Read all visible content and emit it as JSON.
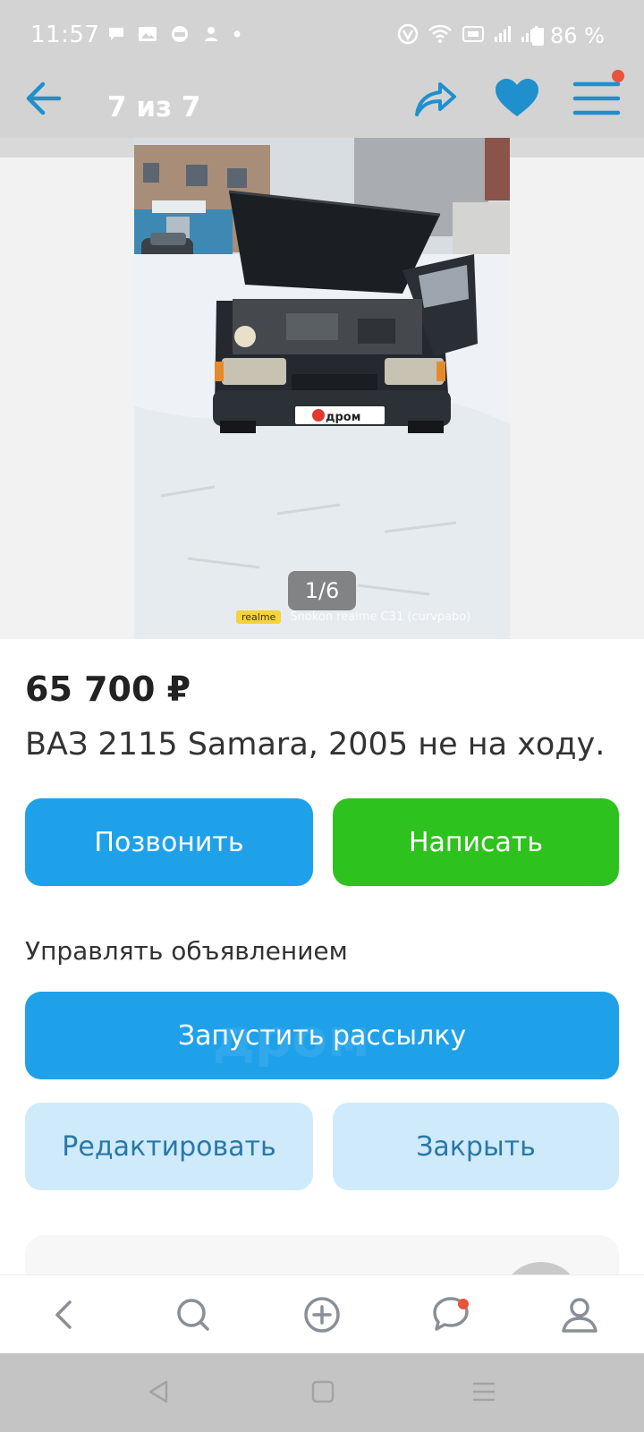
{
  "status_bar": {
    "time": "11:57",
    "battery_percent": "86 %",
    "notification_icons": [
      "chat-bubble-icon",
      "image-icon",
      "car-icon",
      "person-icon",
      "dot-icon"
    ],
    "system_icons": [
      "vpn-icon",
      "wifi-icon",
      "volte-icon",
      "signal-icon",
      "signal-icon"
    ]
  },
  "app_bar": {
    "back_icon": "arrow-left-icon",
    "title": "7 из 7",
    "share_icon": "share-icon",
    "favorite_icon": "heart-icon",
    "menu_icon": "hamburger-icon",
    "has_menu_badge": true,
    "accent_color": "#1fa1ea"
  },
  "gallery": {
    "counter": "1/6",
    "plate_text": "дром",
    "watermark_brand": "realme",
    "watermark_text": "Snokon realme C31 (curvpabo)"
  },
  "listing": {
    "price": "65 700 ₽",
    "title": "ВАЗ 2115 Samara, 2005 не на ходу."
  },
  "actions": {
    "call_label": "Позвонить",
    "write_label": "Написать",
    "call_color": "#1fa1ea",
    "write_color": "#2ec21e"
  },
  "manage": {
    "heading": "Управлять объявлением",
    "broadcast_label": "Запустить рассылку",
    "broadcast_watermark": "дром",
    "edit_label": "Редактировать",
    "close_label": "Закрыть"
  },
  "bottom_nav": {
    "items": [
      {
        "icon": "chevron-left-icon"
      },
      {
        "icon": "search-icon"
      },
      {
        "icon": "plus-circle-icon"
      },
      {
        "icon": "chat-icon",
        "badge": true
      },
      {
        "icon": "profile-icon"
      }
    ]
  },
  "system_nav": {
    "items": [
      "triangle-back-icon",
      "square-home-icon",
      "lines-recents-icon"
    ]
  }
}
